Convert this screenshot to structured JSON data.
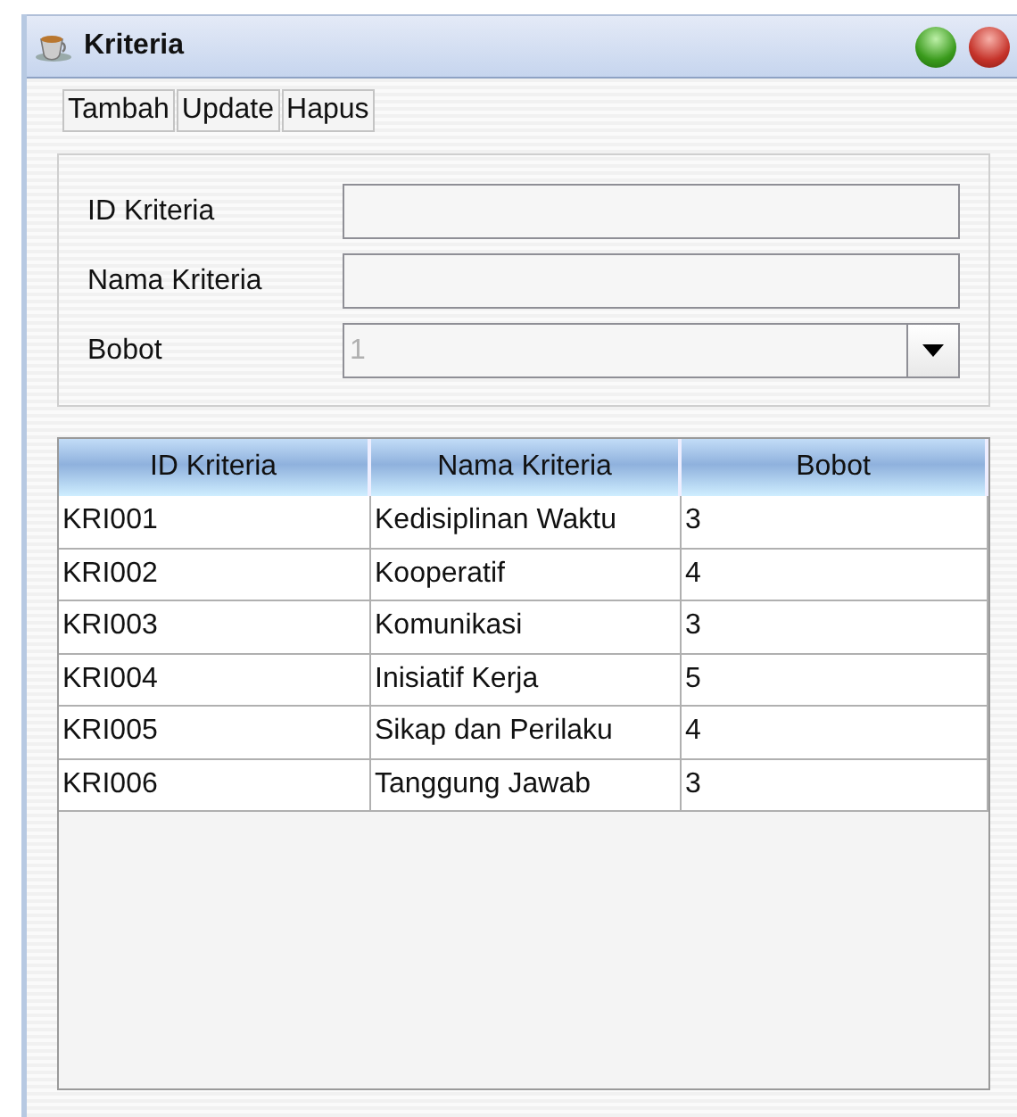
{
  "window": {
    "title": "Kriteria"
  },
  "toolbar": [
    "Tambah",
    "Update",
    "Hapus"
  ],
  "form": {
    "fields": [
      {
        "kind": "text",
        "label": "ID Kriteria"
      },
      {
        "kind": "text",
        "label": "Nama Kriteria"
      },
      {
        "kind": "combo",
        "label": "Bobot",
        "value": "1",
        "disabled": true
      }
    ]
  },
  "table": {
    "columns": [
      "ID Kriteria",
      "Nama Kriteria",
      "Bobot"
    ],
    "rows": [
      [
        "KRI001",
        "Kedisiplinan Waktu",
        "3"
      ],
      [
        "KRI002",
        "Kooperatif",
        "4"
      ],
      [
        "KRI003",
        "Komunikasi",
        "3"
      ],
      [
        "KRI004",
        "Inisiatif Kerja",
        "5"
      ],
      [
        "KRI005",
        "Sikap dan Perilaku",
        "4"
      ],
      [
        "KRI006",
        "Tanggung Jawab",
        "3"
      ]
    ]
  }
}
